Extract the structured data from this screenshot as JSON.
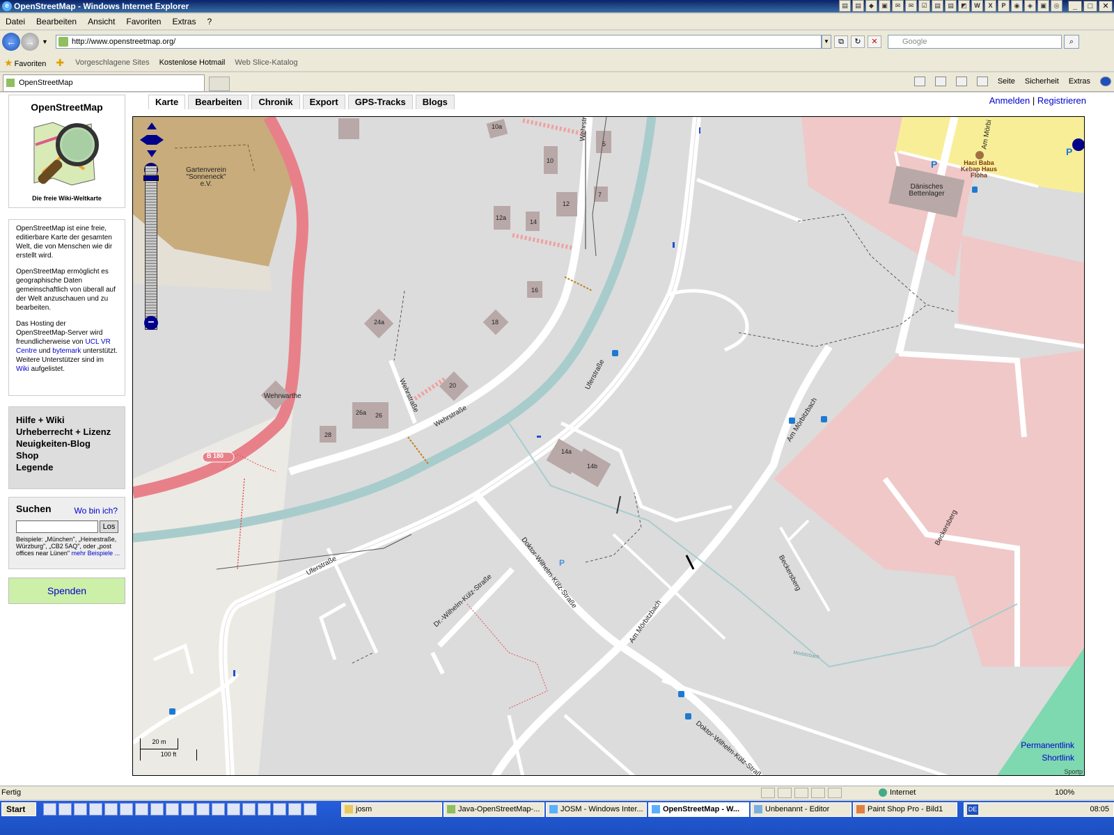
{
  "window": {
    "title": "OpenStreetMap - Windows Internet Explorer"
  },
  "menu": [
    "Datei",
    "Bearbeiten",
    "Ansicht",
    "Favoriten",
    "Extras",
    "?"
  ],
  "address": {
    "url": "http://www.openstreetmap.org/",
    "search_placeholder": "Google"
  },
  "favorites_bar": {
    "favorites_label": "Favoriten",
    "items": [
      "Vorgeschlagene Sites",
      "Kostenlose Hotmail",
      "Web Slice-Katalog"
    ]
  },
  "browser_tab": {
    "label": "OpenStreetMap"
  },
  "command_bar": {
    "page": "Seite",
    "security": "Sicherheit",
    "tools": "Extras"
  },
  "sidebar": {
    "title": "OpenStreetMap",
    "caption": "Die freie Wiki-Weltkarte",
    "intro_p1": "OpenStreetMap ist eine freie, editierbare Karte der gesamten Welt, die von Menschen wie dir erstellt wird.",
    "intro_p2": "OpenStreetMap ermöglicht es geographische Daten gemeinschaftlich von überall auf der Welt anzuschauen und zu bearbeiten.",
    "intro_p3_a": "Das Hosting der OpenStreetMap-Server wird freundlicherweise von",
    "intro_link_ucl": "UCL VR Centre",
    "intro_p3_b": "und",
    "intro_link_bytemark": "bytemark",
    "intro_p3_c": "unterstützt. Weitere Unterstützer sind im",
    "intro_link_wiki": "Wiki",
    "intro_p3_d": "aufgelistet.",
    "links": [
      "Hilfe + Wiki",
      "Urheberrecht + Lizenz",
      "Neuigkeiten-Blog",
      "Shop",
      "Legende"
    ],
    "search_title": "Suchen",
    "where_am_i": "Wo bin ich?",
    "search_button": "Los",
    "search_examples": "Beispiele: „München\", „Heinestraße, Würzburg\", „CB2 5AQ\", oder „post offices near Lünen\"",
    "more_examples": "mehr Beispiele ...",
    "donate": "Spenden"
  },
  "map_tabs": [
    "Karte",
    "Bearbeiten",
    "Chronik",
    "Export",
    "GPS-Tracks",
    "Blogs"
  ],
  "account": {
    "login": "Anmelden",
    "separator": "|",
    "register": "Registrieren"
  },
  "map": {
    "labels": {
      "garden": "Gartenverein \"Sonneneck\" e.V.",
      "wehrwarthe": "Wehrwarthe",
      "danisches": "Dänisches Bettenlager",
      "haci": "Haci Baba Kebap Haus Flöha",
      "b180": "B 180",
      "wehrstrasse1": "Wehrstraße",
      "wehrstrasse2": "Wehrstraße",
      "wehrstrasse_top": "Wehrstr",
      "uferstrasse1": "Uferstraße",
      "uferstrasse2": "Uferstraße",
      "am_morbitzbach1": "Am Mörbitzbach",
      "am_morbitzbach2": "Am Mörbitzbach",
      "am_morbi_top": "Am Mörbi",
      "beckersberg1": "Beckersberg",
      "beckersberg2": "Beckersberg",
      "dr_wilhelm": "Dr.-Wilhelm-Külz-Straße",
      "doktor1": "Doktor-Wilhelm-Külz-Straße",
      "doktor2": "Doktor-Wilhelm-Külz-Straße",
      "morbitzbach_stream": "Mörbitzbach"
    },
    "house_numbers": [
      "10a",
      "5",
      "10",
      "7",
      "12",
      "12a",
      "14",
      "16",
      "18",
      "24a",
      "20",
      "26a",
      "26",
      "28",
      "14a",
      "14b"
    ],
    "scale_metric": "20 m",
    "scale_imperial": "100 ft",
    "permalink": "Permanentlink",
    "shortlink": "Shortlink",
    "attribution": "Sportp"
  },
  "status": {
    "text": "Fertig",
    "zone": "Internet",
    "zoom": "100%"
  },
  "taskbar": {
    "start": "Start",
    "buttons": [
      "josm",
      "Java-OpenStreetMap-...",
      "JOSM - Windows Inter...",
      "OpenStreetMap - W...",
      "Unbenannt - Editor",
      "Paint Shop Pro - Bild1"
    ],
    "lang": "DE",
    "clock": "08:05"
  }
}
